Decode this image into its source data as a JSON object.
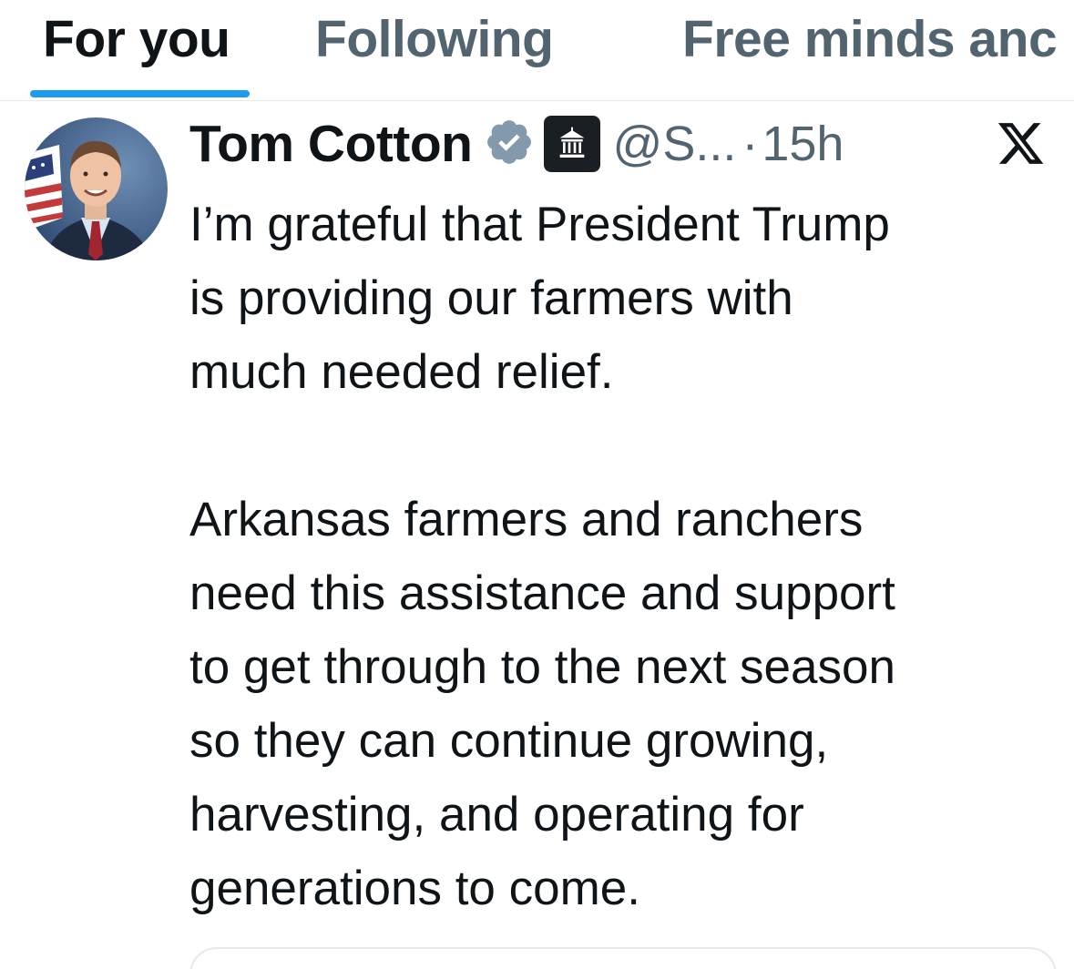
{
  "tabs": [
    {
      "label": "For you",
      "active": true
    },
    {
      "label": "Following",
      "active": false
    },
    {
      "label": "Free minds anc",
      "active": false
    }
  ],
  "colors": {
    "accent": "#1d9bf0",
    "text_primary": "#0f1419",
    "text_secondary": "#536471",
    "verified_badge": "#829aab"
  },
  "tweet": {
    "display_name": "Tom Cotton",
    "verified_icon": "verified-badge-icon",
    "affiliation_icon": "government-building-icon",
    "handle": "@S...",
    "separator": "·",
    "time": "15h",
    "close_icon": "x-logo-icon",
    "text_lines": [
      "I’m grateful that President Trump",
      "is providing our farmers with",
      "much needed relief.",
      "",
      "Arkansas farmers and ranchers",
      "need this assistance and support",
      "to get through to the next season",
      "so they can continue growing,",
      "harvesting, and operating for",
      "generations to come."
    ]
  }
}
